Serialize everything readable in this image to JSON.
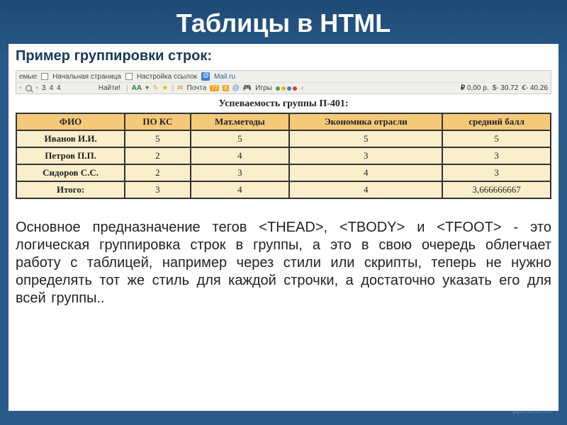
{
  "slide": {
    "title": "Таблицы в HTML",
    "subtitle": "Пример группировки строк:"
  },
  "toolbar": {
    "row1": {
      "item1": "емые",
      "item2": "Начальная страница",
      "item3": "Настройка ссылок",
      "item4": "Mail.ru"
    },
    "row2": {
      "z1": "3",
      "z2": "4",
      "z3": "4",
      "find": "Найти!",
      "aa": "AА",
      "mail_label": "Почта",
      "mail_count": "77",
      "ok": "8",
      "games": "Игры",
      "price": "0,00 р.",
      "usd": "$- 30.72",
      "eur": "€- 40.26"
    }
  },
  "chart_data": {
    "type": "table",
    "title": "Успеваемость группы П-401:",
    "columns": [
      "ФИО",
      "ПО КС",
      "Мат.методы",
      "Экономика отрасли",
      "средний балл"
    ],
    "rows": [
      {
        "c0": "Иванов И.И.",
        "c1": "5",
        "c2": "5",
        "c3": "5",
        "c4": "5"
      },
      {
        "c0": "Петров П.П.",
        "c1": "2",
        "c2": "4",
        "c3": "3",
        "c4": "3"
      },
      {
        "c0": "Сидоров С.С.",
        "c1": "2",
        "c2": "3",
        "c3": "4",
        "c4": "3"
      },
      {
        "c0": "Итого:",
        "c1": "3",
        "c2": "4",
        "c3": "4",
        "c4": "3,666666667"
      }
    ]
  },
  "body": {
    "text": "Основное предназначение тегов <THEAD>, <TBODY> и <TFOOT> - это логическая группировка строк в группы, а это в свою очередь облегчает работу с таблицей, например через стили или скрипты, теперь не нужно определять тот же стиль для каждой строчки, а достаточно указать его для всей группы.."
  },
  "watermark": "pptcloud.ru"
}
